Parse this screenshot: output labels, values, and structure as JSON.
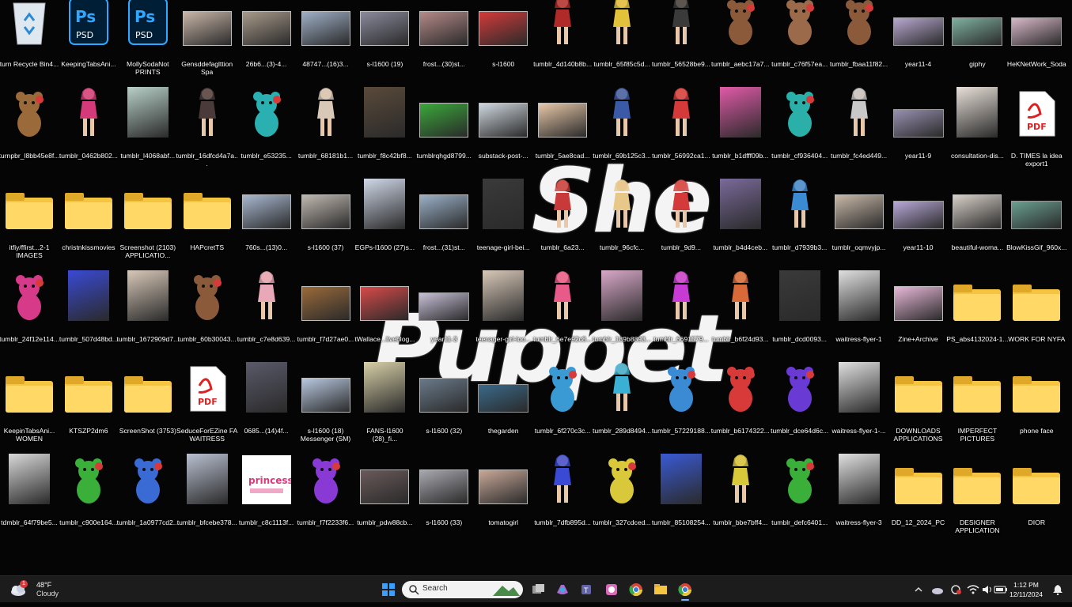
{
  "colors": {
    "desktop_bg": "#050505",
    "taskbar_bg": "#1c1c1c",
    "accent": "#0078d4"
  },
  "wallpaper": {
    "word1": "She",
    "word2": "Puppet"
  },
  "desktop_icons": [
    {
      "label": "turn Recycle Bin4...",
      "kind": "bin",
      "color": "#dfe8ee"
    },
    {
      "label": "KeepingTabsAni...",
      "kind": "psd",
      "color": "#001e36"
    },
    {
      "label": "MollySodaNot PRINTS",
      "kind": "psd",
      "color": "#001e36"
    },
    {
      "label": "Gensddefaglttion Spa",
      "kind": "photo",
      "color": "#c9b6a8"
    },
    {
      "label": "26b6...(3)-4...",
      "kind": "photo",
      "color": "#a89a8a"
    },
    {
      "label": "48747...(16)3...",
      "kind": "photo",
      "color": "#9fb0c8"
    },
    {
      "label": "s-l1600 (19)",
      "kind": "photo",
      "color": "#8a8a9c"
    },
    {
      "label": "frost...(30)st...",
      "kind": "photo",
      "color": "#b48a88"
    },
    {
      "label": "s-l1600",
      "kind": "photo",
      "color": "#d43a3a"
    },
    {
      "label": "tumblr_4d140b8b...",
      "kind": "figure",
      "color": "#b02a2a"
    },
    {
      "label": "tumblr_65f85c5d...",
      "kind": "figure",
      "color": "#e2c23a"
    },
    {
      "label": "tumblr_56528be9...",
      "kind": "figure",
      "color": "#3a3a3a"
    },
    {
      "label": "tumblr_aebc17a7...",
      "kind": "bear",
      "color": "#8a5a3a"
    },
    {
      "label": "tumblr_c76f57ea...",
      "kind": "bear",
      "color": "#9a6a4a"
    },
    {
      "label": "tumblr_fbaa11f82...",
      "kind": "bear",
      "color": "#8a5a3a"
    },
    {
      "label": "year11-4",
      "kind": "wide",
      "color": "#b8a8d0"
    },
    {
      "label": "giphy",
      "kind": "wide",
      "color": "#7fb0a0"
    },
    {
      "label": "HeKNetWork_Soda",
      "kind": "wide",
      "color": "#d8b8c8"
    },
    {
      "label": "turnpbr_l8bb45e8f...",
      "kind": "bear",
      "color": "#9a6a3a"
    },
    {
      "label": "tumblr_0462b802...",
      "kind": "figure",
      "color": "#d43a7a"
    },
    {
      "label": "tumblr_l4068abf...",
      "kind": "tall2",
      "color": "#b8d0c8"
    },
    {
      "label": "tumblr_16dfcd4a7a...",
      "kind": "figure",
      "color": "#4a3a3a"
    },
    {
      "label": "tumblr_e53235...",
      "kind": "bear",
      "color": "#2ab0b0"
    },
    {
      "label": "tumblr_68181b1...",
      "kind": "figure",
      "color": "#d8c8b8"
    },
    {
      "label": "tumblr_f8c42bf8...",
      "kind": "tall2",
      "color": "#5a4a3a"
    },
    {
      "label": "tumblrqhgd8799...",
      "kind": "photo",
      "color": "#3aa83a"
    },
    {
      "label": "substack-post-...",
      "kind": "photo",
      "color": "#d0d8e0"
    },
    {
      "label": "tumblr_5ae8cad...",
      "kind": "photo",
      "color": "#e8c8a8"
    },
    {
      "label": "tumblr_69b125c3...",
      "kind": "figure",
      "color": "#3a5aa8"
    },
    {
      "label": "tumblr_56992ca1...",
      "kind": "figure",
      "color": "#d43a3a"
    },
    {
      "label": "tumblr_b1dfff09b...",
      "kind": "tall2",
      "color": "#e05aa8"
    },
    {
      "label": "tumblr_cf936404...",
      "kind": "bear",
      "color": "#2ab0a8"
    },
    {
      "label": "tumblr_fc4ed449...",
      "kind": "figure",
      "color": "#c8c8c8"
    },
    {
      "label": "year11-9",
      "kind": "wide",
      "color": "#9890b0"
    },
    {
      "label": "consultation-dis...",
      "kind": "tall2",
      "color": "#e8e0d8"
    },
    {
      "label": "D. TIMES la idea export1",
      "kind": "pdf",
      "color": "#e02020"
    },
    {
      "label": "itfiy/ffirst...2-1 IMAGES",
      "kind": "folder",
      "color": "#f5c542"
    },
    {
      "label": "christnkissmovies",
      "kind": "folder",
      "color": "#f5c542"
    },
    {
      "label": "Screenshot (2103) APPLICATIO...",
      "kind": "folder",
      "color": "#f5c542"
    },
    {
      "label": "HAPcretTS",
      "kind": "folder",
      "color": "#f5c542"
    },
    {
      "label": "760s...(13)0...",
      "kind": "photo",
      "color": "#a8b8d0"
    },
    {
      "label": "s-l1600 (37)",
      "kind": "photo",
      "color": "#c0b8b0"
    },
    {
      "label": "EGPs-l1600 (27)s...",
      "kind": "tall2",
      "color": "#d0d8e8"
    },
    {
      "label": "frost...(31)st...",
      "kind": "photo",
      "color": "#9ab0c8"
    },
    {
      "label": "teenage-girl-bei...",
      "kind": "tall2",
      "color": "#3a3a3a"
    },
    {
      "label": "tumblr_6a23...",
      "kind": "figure",
      "color": "#c83a3a"
    },
    {
      "label": "tumblr_96cfc...",
      "kind": "figure",
      "color": "#e8c888"
    },
    {
      "label": "tumblr_9d9...",
      "kind": "figure",
      "color": "#d43a3a"
    },
    {
      "label": "tumblr_b4d4ceb...",
      "kind": "tall2",
      "color": "#7a6a9a"
    },
    {
      "label": "tumblr_d7939b3...",
      "kind": "figure",
      "color": "#3a8ad4"
    },
    {
      "label": "tumblr_oqmvyjp...",
      "kind": "photo",
      "color": "#c8b8a8"
    },
    {
      "label": "year11-10",
      "kind": "wide",
      "color": "#b8a8d8"
    },
    {
      "label": "beautiful-woma...",
      "kind": "photo",
      "color": "#d8d0c8"
    },
    {
      "label": "BlowKissGif_960x...",
      "kind": "wide",
      "color": "#6aa090"
    },
    {
      "label": "tumblr_24f12e114...",
      "kind": "bear",
      "color": "#d83a8a"
    },
    {
      "label": "tumblr_507d48bd...",
      "kind": "tall2",
      "color": "#3a4ad4"
    },
    {
      "label": "tumblr_1672909d7...",
      "kind": "tall2",
      "color": "#d8c8b8"
    },
    {
      "label": "tumblr_60b30043...",
      "kind": "bear",
      "color": "#8a5a3a"
    },
    {
      "label": "tumblr_c7e8d639...",
      "kind": "figure",
      "color": "#e8a8b8"
    },
    {
      "label": "tumblr_f7d27ae0...",
      "kind": "photo",
      "color": "#9a6a3a"
    },
    {
      "label": "tWallace...liveblog...",
      "kind": "photo",
      "color": "#d84a4a"
    },
    {
      "label": "year11-3",
      "kind": "wide",
      "color": "#c8c0d8"
    },
    {
      "label": "teenager-girl-loo...",
      "kind": "tall2",
      "color": "#d8c8b8"
    },
    {
      "label": "tumblr_6e7e92c8...",
      "kind": "figure",
      "color": "#e85a8a"
    },
    {
      "label": "tumblr_189b8893...",
      "kind": "tall2",
      "color": "#d8a8c8"
    },
    {
      "label": "tumblr_6691579...",
      "kind": "figure",
      "color": "#c83ad4"
    },
    {
      "label": "tumblr_b6f24d93...",
      "kind": "figure",
      "color": "#d86a3a"
    },
    {
      "label": "tumblr_dcd0093...",
      "kind": "tall2",
      "color": "#3a3a3a"
    },
    {
      "label": "waitress-flyer-1",
      "kind": "tall2",
      "color": "#e0e0e0"
    },
    {
      "label": "Zine+Archive",
      "kind": "photo",
      "color": "#e8b8d8"
    },
    {
      "label": "PS_abs4132024-1...",
      "kind": "folder",
      "color": "#f5c542"
    },
    {
      "label": "WORK FOR NYFA",
      "kind": "folder",
      "color": "#f5c542"
    },
    {
      "label": "KeepinTabsAni... WOMEN",
      "kind": "folder",
      "color": "#f5c542"
    },
    {
      "label": "KTSZP2dm6",
      "kind": "folder",
      "color": "#f5c542"
    },
    {
      "label": "ScreenShot (3753)",
      "kind": "folder",
      "color": "#f5c542"
    },
    {
      "label": "SeduceForEZine FA WAITRESS",
      "kind": "pdf",
      "color": "#e02020"
    },
    {
      "label": "0685...(14)4f...",
      "kind": "tall2",
      "color": "#5a5a6a"
    },
    {
      "label": "s-l1600 (18) Messenger (SM)",
      "kind": "photo",
      "color": "#b8c8e0"
    },
    {
      "label": "FANS-l1600 (28)_fi...",
      "kind": "tall2",
      "color": "#d8d0a8"
    },
    {
      "label": "s-l1600 (32)",
      "kind": "photo",
      "color": "#6a7a8a"
    },
    {
      "label": "thegarden",
      "kind": "wide",
      "color": "#3a6a8a"
    },
    {
      "label": "tumblr_6f270c3c...",
      "kind": "bear",
      "color": "#3a9ad4"
    },
    {
      "label": "tumblr_289d8494...",
      "kind": "figure",
      "color": "#3ab0d4"
    },
    {
      "label": "tumblr_57229188...",
      "kind": "bear",
      "color": "#3a8ad4"
    },
    {
      "label": "tumblr_b6174322...",
      "kind": "bear",
      "color": "#d83a3a"
    },
    {
      "label": "tumblr_dce64d6c...",
      "kind": "bear",
      "color": "#6a3ad4"
    },
    {
      "label": "waitress-flyer-1-...",
      "kind": "tall2",
      "color": "#e0e0e0"
    },
    {
      "label": "DOWNLOADS APPLICATIONS",
      "kind": "folder",
      "color": "#f5c542"
    },
    {
      "label": "IMPERFECT PICTURES",
      "kind": "folder",
      "color": "#f5c542"
    },
    {
      "label": "phone face",
      "kind": "folder",
      "color": "#f5c542"
    },
    {
      "label": "tdmblr_64f79be5...",
      "kind": "tall2",
      "color": "#d8d8d8"
    },
    {
      "label": "tumblr_c900e164...",
      "kind": "bear",
      "color": "#3ab03a"
    },
    {
      "label": "tumblr_1a0977cd2...",
      "kind": "bear",
      "color": "#3a6ad4"
    },
    {
      "label": "tumblr_bfcebe378...",
      "kind": "tall2",
      "color": "#b8c0d0"
    },
    {
      "label": "tumblr_c8c1113f...",
      "kind": "txtimg",
      "color": "#ffffff"
    },
    {
      "label": "tumblr_f7f2233f6...",
      "kind": "bear",
      "color": "#8a3ad4"
    },
    {
      "label": "tumblr_pdw88cb...",
      "kind": "photo",
      "color": "#6a5a5a"
    },
    {
      "label": "s-l1600 (33)",
      "kind": "photo",
      "color": "#a8a8b0"
    },
    {
      "label": "tomatogirl",
      "kind": "photo",
      "color": "#c8a898"
    },
    {
      "label": "tumblr_7dfb895d...",
      "kind": "figure",
      "color": "#3a4ad4"
    },
    {
      "label": "tumblr_327cdced...",
      "kind": "bear",
      "color": "#d8c83a"
    },
    {
      "label": "tumblr_85108254...",
      "kind": "tall2",
      "color": "#3a5ad4"
    },
    {
      "label": "tumblr_bbe7bff4...",
      "kind": "figure",
      "color": "#d8c83a"
    },
    {
      "label": "tumblr_defc6401...",
      "kind": "bear",
      "color": "#3ab03a"
    },
    {
      "label": "waitress-flyer-3",
      "kind": "tall2",
      "color": "#e0e0e0"
    },
    {
      "label": "DD_12_2024_PC",
      "kind": "folder",
      "color": "#f5c542"
    },
    {
      "label": "DESIGNER APPLICATION",
      "kind": "folder",
      "color": "#f5c542"
    },
    {
      "label": "DIOR",
      "kind": "folder",
      "color": "#f5c542"
    }
  ],
  "taskbar": {
    "weather": {
      "temp": "48°F",
      "condition": "Cloudy",
      "badge": "1"
    },
    "search": {
      "placeholder": "Search"
    },
    "apps": [
      {
        "name": "start-button",
        "color": "#3aa0ff"
      },
      {
        "name": "task-view",
        "color": "#b8b8b8"
      },
      {
        "name": "copilot",
        "color": "#a86ad4"
      },
      {
        "name": "teams",
        "color": "#6264a7"
      },
      {
        "name": "photos",
        "color": "#d86ab8"
      },
      {
        "name": "chrome",
        "color": "#e8c83a"
      },
      {
        "name": "file-explorer",
        "color": "#f5c542"
      },
      {
        "name": "chrome-active",
        "color": "#d84a3a"
      }
    ],
    "clock": {
      "time": "1:12 PM",
      "date": "12/11/2024"
    }
  }
}
